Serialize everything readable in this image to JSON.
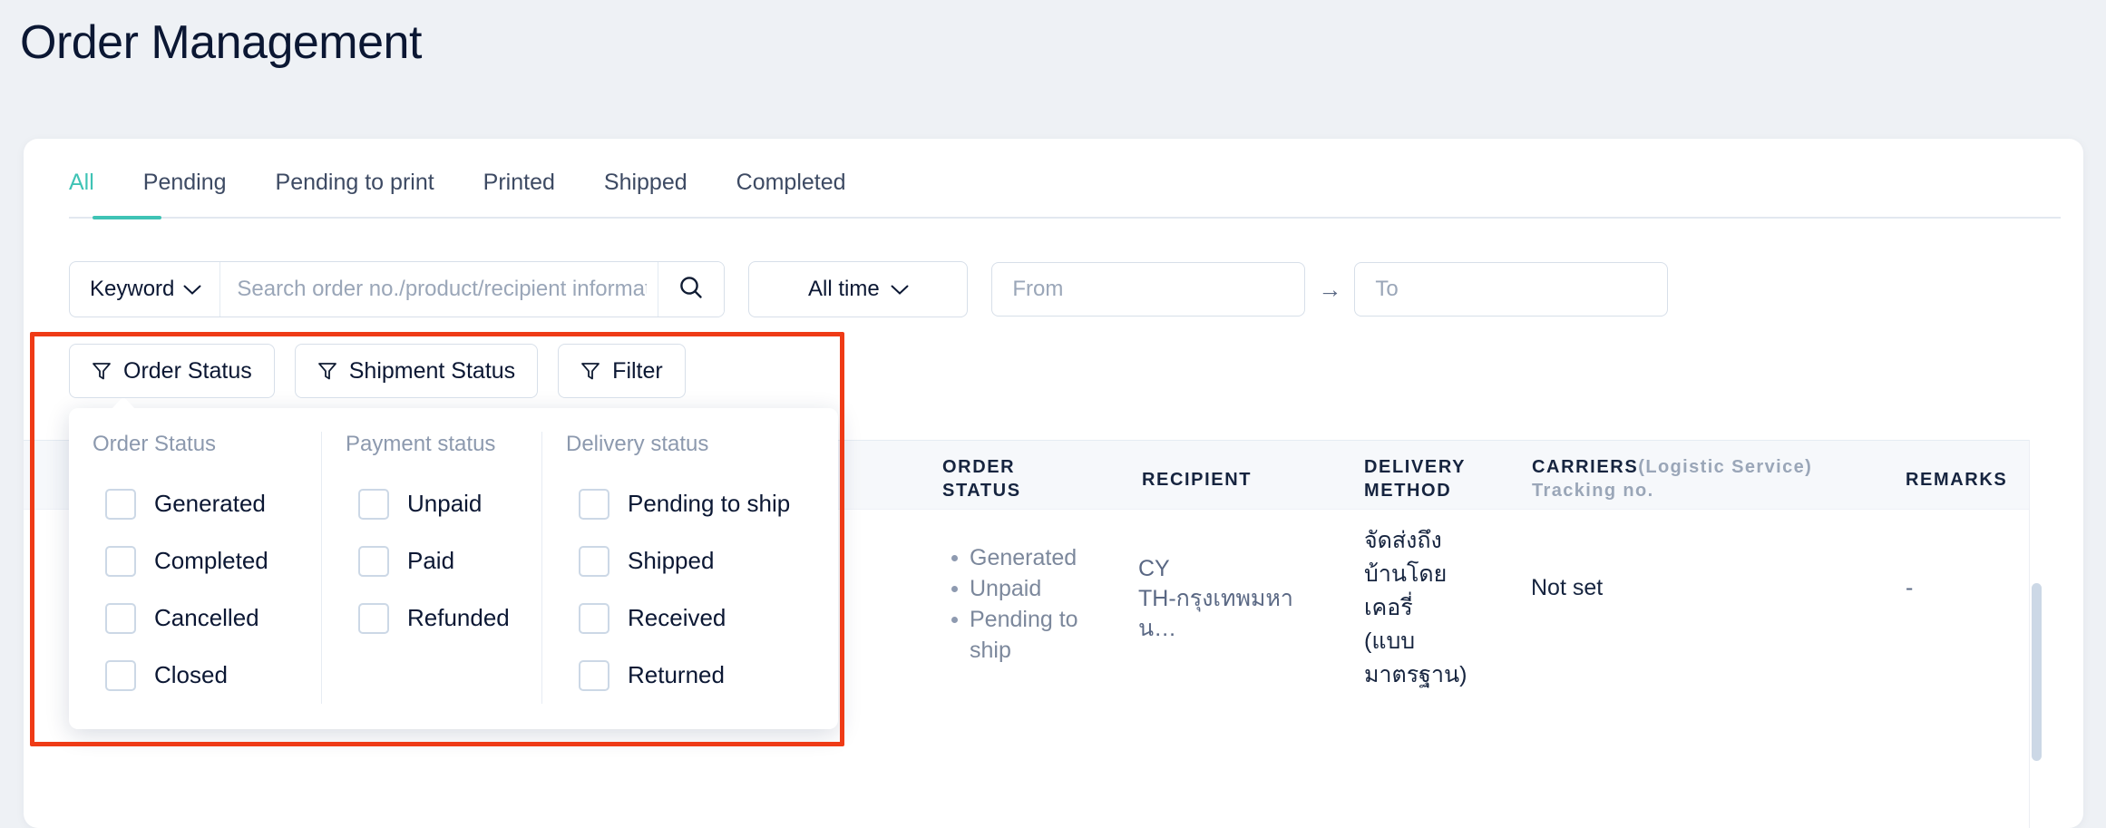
{
  "page": {
    "title": "Order Management",
    "background_color": "#eef1f5",
    "accent_color": "#3fc3b5",
    "highlight_color": "#ef3b16"
  },
  "tabs": [
    {
      "label": "All",
      "active": true
    },
    {
      "label": "Pending",
      "active": false
    },
    {
      "label": "Pending to print",
      "active": false
    },
    {
      "label": "Printed",
      "active": false
    },
    {
      "label": "Shipped",
      "active": false
    },
    {
      "label": "Completed",
      "active": false
    }
  ],
  "search": {
    "keyword_label": "Keyword",
    "keyword_caret": "chevron-down-icon",
    "input_value": "",
    "placeholder": "Search order no./product/recipient information/carri",
    "search_icon": "search-icon"
  },
  "date_filter": {
    "time_range_label": "All time",
    "time_caret": "chevron-down-icon",
    "from_value": "",
    "from_placeholder": "From",
    "arrow": "→",
    "to_value": "",
    "to_placeholder": "To"
  },
  "filter_buttons": [
    {
      "label": "Order Status",
      "icon": "funnel-icon",
      "active": true
    },
    {
      "label": "Shipment Status",
      "icon": "funnel-icon",
      "active": false
    },
    {
      "label": "Filter",
      "icon": "funnel-icon",
      "active": false
    }
  ],
  "status_dropdown": {
    "columns": [
      {
        "title": "Order Status",
        "items": [
          {
            "label": "Generated",
            "checked": false
          },
          {
            "label": "Completed",
            "checked": false
          },
          {
            "label": "Cancelled",
            "checked": false
          },
          {
            "label": "Closed",
            "checked": false
          }
        ]
      },
      {
        "title": "Payment status",
        "items": [
          {
            "label": "Unpaid",
            "checked": false
          },
          {
            "label": "Paid",
            "checked": false
          },
          {
            "label": "Refunded",
            "checked": false
          }
        ]
      },
      {
        "title": "Delivery status",
        "items": [
          {
            "label": "Pending to ship",
            "checked": false
          },
          {
            "label": "Shipped",
            "checked": false
          },
          {
            "label": "Received",
            "checked": false
          },
          {
            "label": "Returned",
            "checked": false
          }
        ]
      }
    ]
  },
  "table": {
    "headers": {
      "order_status_line1": "ORDER",
      "order_status_line2": "STATUS",
      "recipient": "RECIPIENT",
      "delivery_method_line1": "DELIVERY",
      "delivery_method_line2": "METHOD",
      "carriers_main": "CARRIERS",
      "carriers_sub": "(Logistic Service)",
      "carriers_line2": "Tracking no.",
      "remarks": "REMARKS"
    },
    "rows": [
      {
        "order_status": [
          "Generated",
          "Unpaid",
          "Pending to ship"
        ],
        "recipient_name": "CY",
        "recipient_address": "TH-กรุงเทพมหาน…",
        "delivery_method": "จัดส่งถึงบ้านโดยเคอรี่ (แบบมาตรฐาน)",
        "carrier": "Not set",
        "remarks": "-"
      }
    ]
  }
}
